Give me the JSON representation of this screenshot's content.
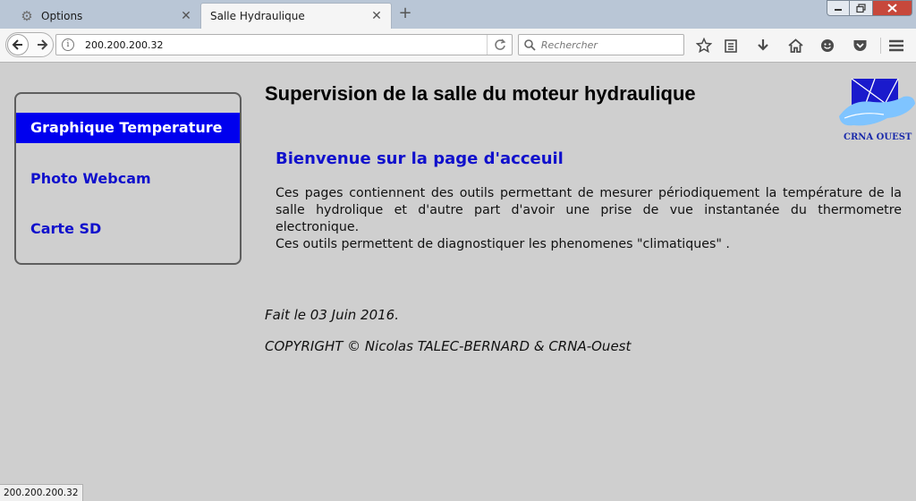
{
  "browser": {
    "tabs": [
      {
        "label": "Options",
        "active": false
      },
      {
        "label": "Salle Hydraulique",
        "active": true
      }
    ],
    "url": "200.200.200.32",
    "search_placeholder": "Rechercher",
    "status_url": "200.200.200.32"
  },
  "page": {
    "title": "Supervision de la salle du moteur hydraulique",
    "logo_text": "CRNA OUEST",
    "menu": [
      {
        "label": "Graphique Temperature",
        "active": true
      },
      {
        "label": "Photo Webcam",
        "active": false
      },
      {
        "label": "Carte SD",
        "active": false
      }
    ],
    "welcome": "Bienvenue sur la page d'acceuil",
    "intro_p1": "Ces pages contiennent des outils permettant de mesurer périodiquement la température de la salle hydrolique et d'autre part d'avoir une prise de vue instantanée du thermometre electronique.",
    "intro_p2": "Ces outils permettent de diagnostiquer les phenomenes \"climatiques\" .",
    "made_on": "Fait le 03 Juin 2016.",
    "copyright": "COPYRIGHT © Nicolas TALEC-BERNARD & CRNA-Ouest"
  },
  "colors": {
    "page_bg": "#cfcfcf",
    "menu_link": "#1010cc",
    "menu_active_bg": "#0000ee",
    "welcome": "#1010cc"
  }
}
